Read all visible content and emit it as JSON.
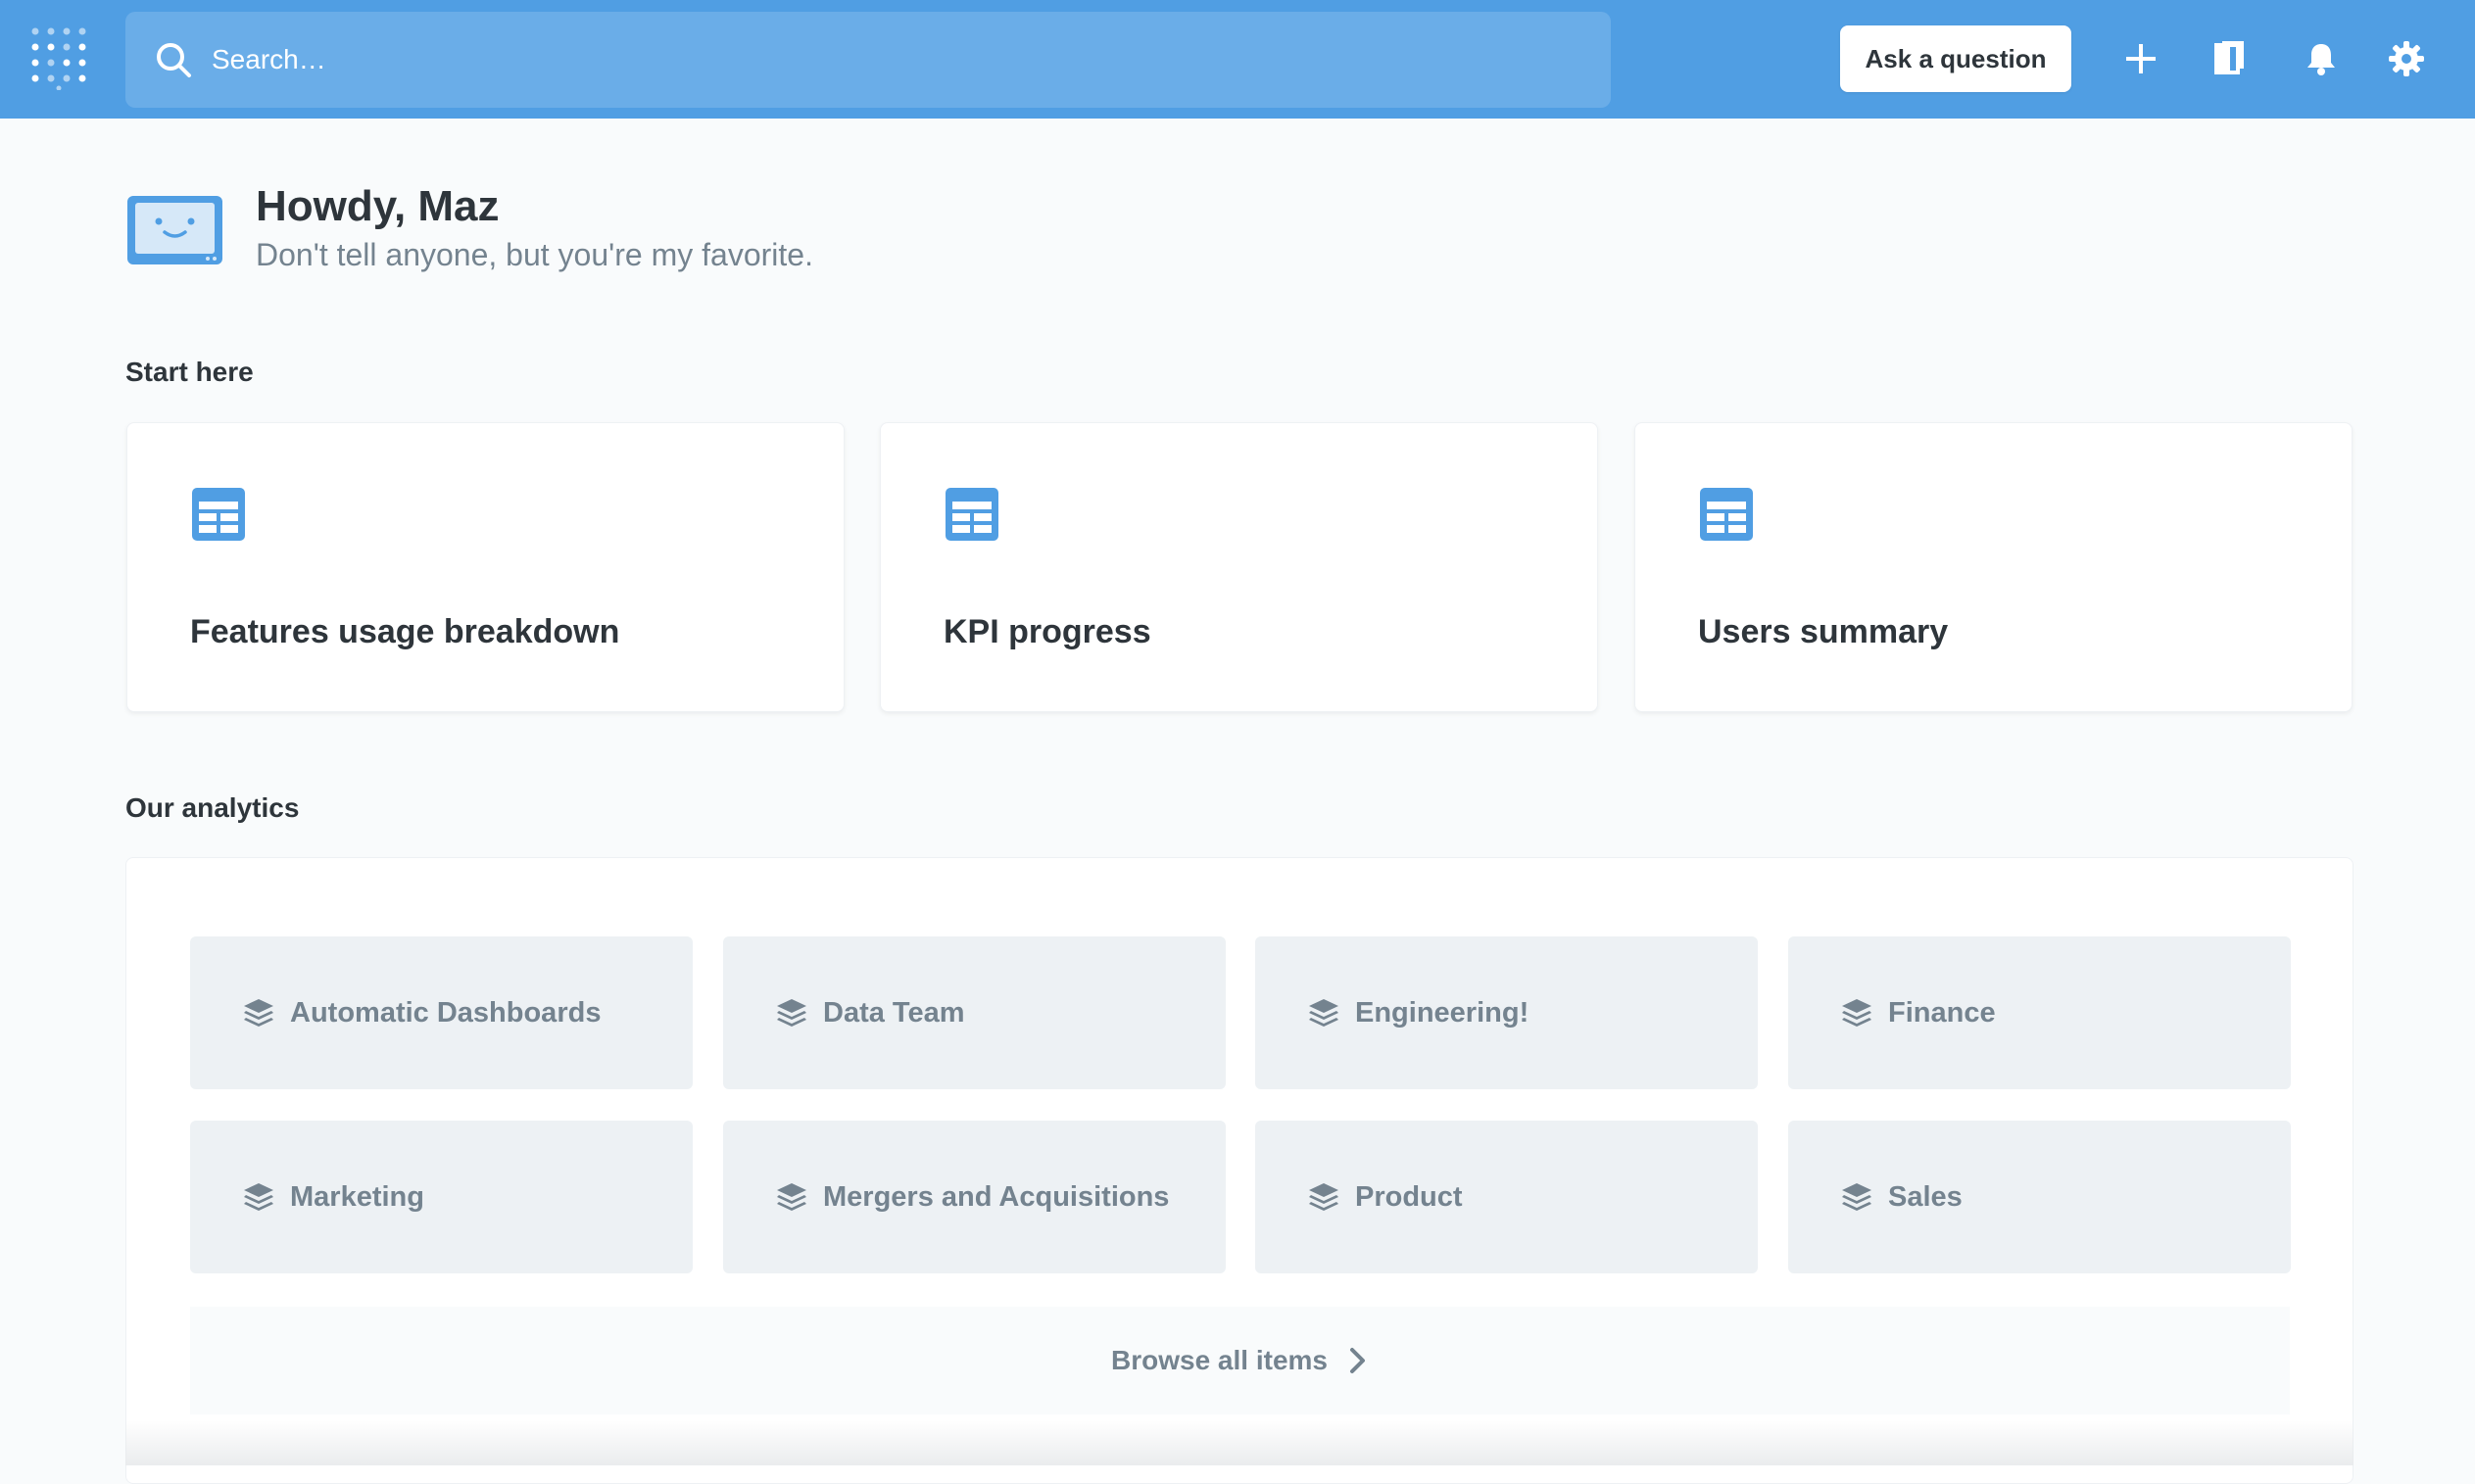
{
  "navbar": {
    "search_placeholder": "Search…",
    "ask_button": "Ask a question",
    "icons": [
      "metabase-logo-icon",
      "search-icon",
      "plus-icon",
      "bookmark-icon",
      "bell-icon",
      "gear-icon"
    ],
    "accent_color": "#509ee3"
  },
  "greeting": {
    "title": "Howdy, Maz",
    "subtitle": "Don't tell anyone, but you're my favorite."
  },
  "start_here": {
    "heading": "Start here",
    "cards": [
      {
        "label": "Features usage breakdown",
        "icon": "dashboard-icon"
      },
      {
        "label": "KPI progress",
        "icon": "dashboard-icon"
      },
      {
        "label": "Users summary",
        "icon": "dashboard-icon"
      }
    ]
  },
  "our_analytics": {
    "heading": "Our analytics",
    "collections": [
      {
        "label": "Automatic Dashboards",
        "icon": "collection-stack-icon"
      },
      {
        "label": "Data Team",
        "icon": "collection-stack-icon"
      },
      {
        "label": "Engineering!",
        "icon": "collection-stack-icon"
      },
      {
        "label": "Finance",
        "icon": "collection-stack-icon"
      },
      {
        "label": "Marketing",
        "icon": "collection-stack-icon"
      },
      {
        "label": "Mergers and Acquisitions",
        "icon": "collection-stack-icon"
      },
      {
        "label": "Product",
        "icon": "collection-stack-icon"
      },
      {
        "label": "Sales",
        "icon": "collection-stack-icon"
      }
    ],
    "browse_all": "Browse all items"
  }
}
